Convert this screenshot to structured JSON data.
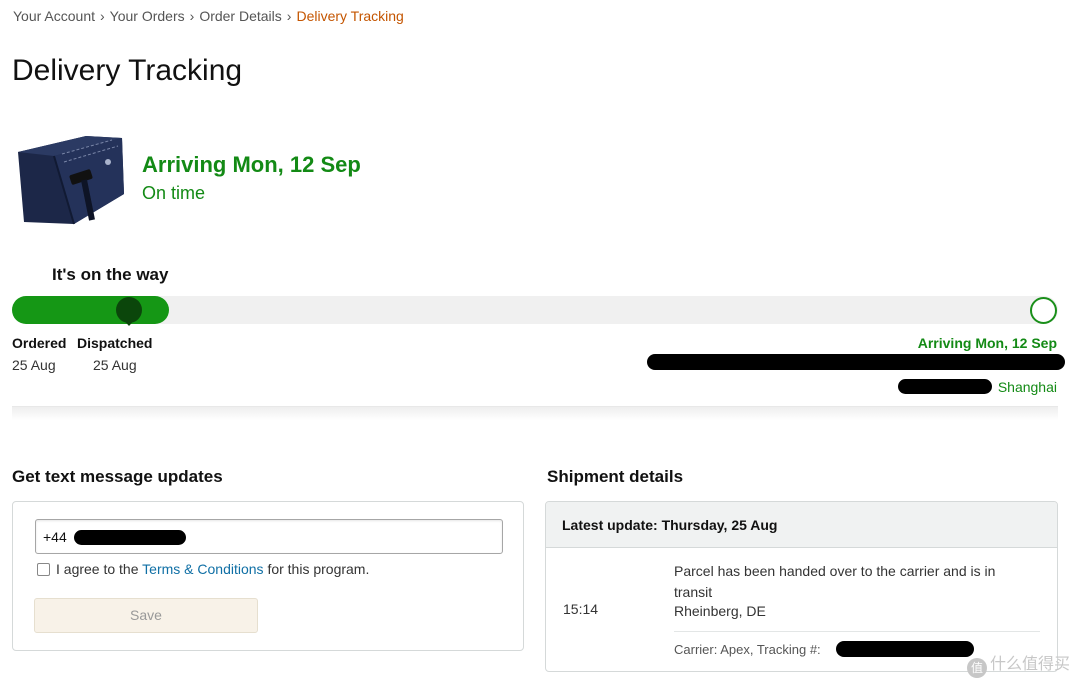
{
  "breadcrumb": {
    "items": [
      "Your Account",
      "Your Orders",
      "Order Details"
    ],
    "current": "Delivery Tracking",
    "separator": "›"
  },
  "page_title": "Delivery Tracking",
  "delivery": {
    "arriving": "Arriving Mon, 12 Sep",
    "status": "On time",
    "headline": "It's on the way",
    "progress_fraction": 0.15,
    "milestones": [
      {
        "label": "Ordered",
        "date": "25 Aug"
      },
      {
        "label": "Dispatched",
        "date": "25 Aug"
      }
    ],
    "arrive_right": "Arriving Mon, 12 Sep",
    "destination": "Shanghai"
  },
  "sms": {
    "title": "Get text message updates",
    "phone_prefix": "+44",
    "agree_prefix": "I agree to the",
    "terms_link": "Terms & Conditions",
    "agree_suffix": "for this program.",
    "save_label": "Save"
  },
  "shipment": {
    "title": "Shipment details",
    "latest_update": "Latest update: Thursday, 25 Aug",
    "time": "15:14",
    "event": "Parcel has been handed over to the carrier and is in transit",
    "place": "Rheinberg, DE",
    "carrier": "Carrier: Apex, Tracking #:"
  },
  "watermark": {
    "badge": "值",
    "text": "什么值得买"
  },
  "colors": {
    "accent_green": "#138a15",
    "progress_green": "#159715",
    "marker_dark": "#0b460b",
    "breadcrumb_current": "#c45500",
    "link_blue": "#0f6fa5"
  }
}
